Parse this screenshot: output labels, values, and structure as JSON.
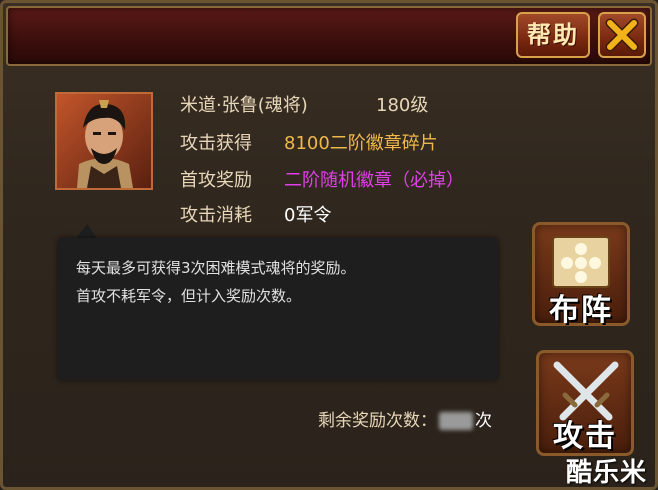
{
  "header": {
    "help_label": "帮助"
  },
  "general": {
    "name": "米道·张鲁(魂将)",
    "level": "180级",
    "rows": [
      {
        "label": "攻击获得",
        "value": "8100二阶徽章碎片",
        "color": "#f0b84a"
      },
      {
        "label": "首攻奖励",
        "value": "二阶随机徽章（必掉）",
        "color": "#e040e8"
      },
      {
        "label": "攻击消耗",
        "value": "0军令",
        "color": "#ffffff"
      }
    ]
  },
  "tooltip": {
    "line1": "每天最多可获得3次困难模式魂将的奖励。",
    "line2": "首攻不耗军令，但计入奖励次数。"
  },
  "buttons": {
    "formation": "布阵",
    "attack": "攻击"
  },
  "remaining": {
    "label": "剩余奖励次数：",
    "suffix": "次"
  },
  "watermark": "酷乐米"
}
